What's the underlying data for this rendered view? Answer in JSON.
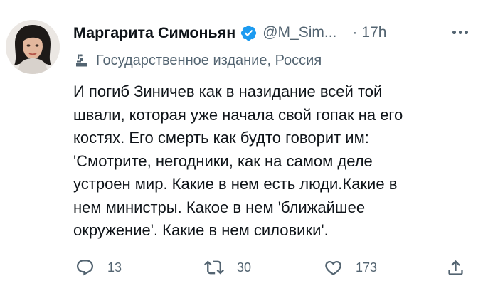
{
  "author": {
    "display_name": "Маргарита Симоньян",
    "handle": "@M_Sim...",
    "separator": "·",
    "time": "17h",
    "verified": true,
    "label": "Государственное издание, Россия"
  },
  "tweet": {
    "lines": [
      "И погиб Зиничев как в назидание всей той",
      "швали, которая уже начала свой гопак на его",
      "костях. Его смерть как будто говорит им:",
      "'Смотрите, негодники, как на самом деле",
      "устроен мир. Какие в нем есть люди.Какие в",
      "нем министры. Какое в нем 'ближайшее",
      "окружение'. Какие в нем силовики'."
    ]
  },
  "actions": {
    "reply_count": "13",
    "retweet_count": "30",
    "like_count": "173"
  },
  "colors": {
    "text": "#0f1419",
    "secondary": "#536471",
    "verified_blue": "#1d9bf0",
    "background": "#ffffff"
  },
  "icons": {
    "verified": "verified-badge-icon",
    "label": "state-media-podium-icon",
    "more": "more-dots-icon",
    "reply": "reply-icon",
    "retweet": "retweet-icon",
    "like": "heart-icon",
    "share": "share-icon"
  }
}
